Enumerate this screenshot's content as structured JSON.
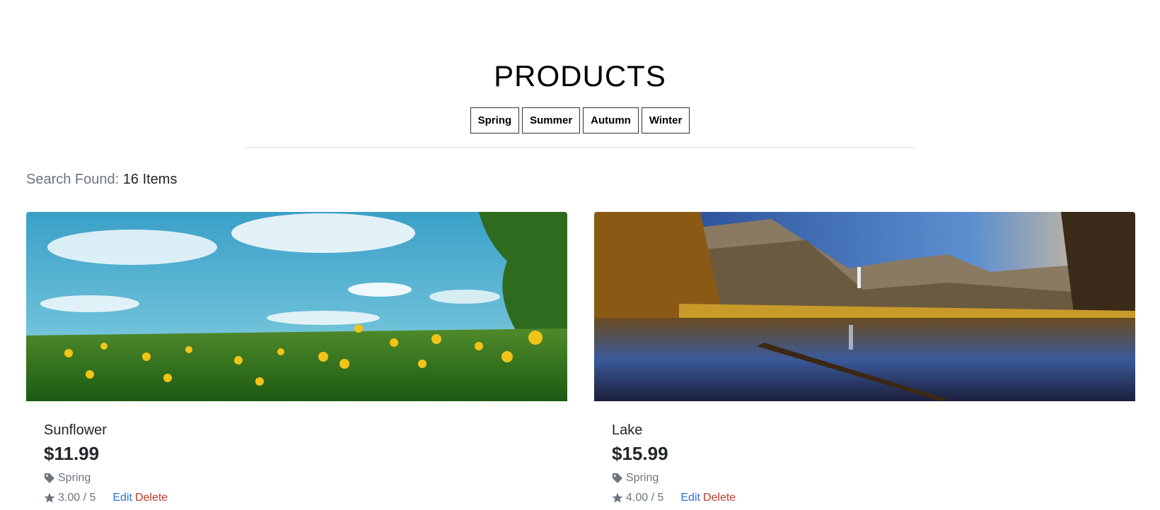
{
  "header": {
    "title": "PRODUCTS",
    "filters": [
      "Spring",
      "Summer",
      "Autumn",
      "Winter"
    ]
  },
  "search": {
    "label": "Search Found:",
    "count_text": "16 Items"
  },
  "products": [
    {
      "name": "Sunflower",
      "price": "$11.99",
      "category": "Spring",
      "rating": "3.00 / 5",
      "edit_label": "Edit",
      "delete_label": "Delete"
    },
    {
      "name": "Lake",
      "price": "$15.99",
      "category": "Spring",
      "rating": "4.00 / 5",
      "edit_label": "Edit",
      "delete_label": "Delete"
    }
  ],
  "icons": {
    "tag": "tag-icon",
    "star": "star-icon"
  },
  "colors": {
    "edit_link": "#2f6fd0",
    "delete_link": "#c0392b",
    "muted_text": "#6c757d"
  }
}
